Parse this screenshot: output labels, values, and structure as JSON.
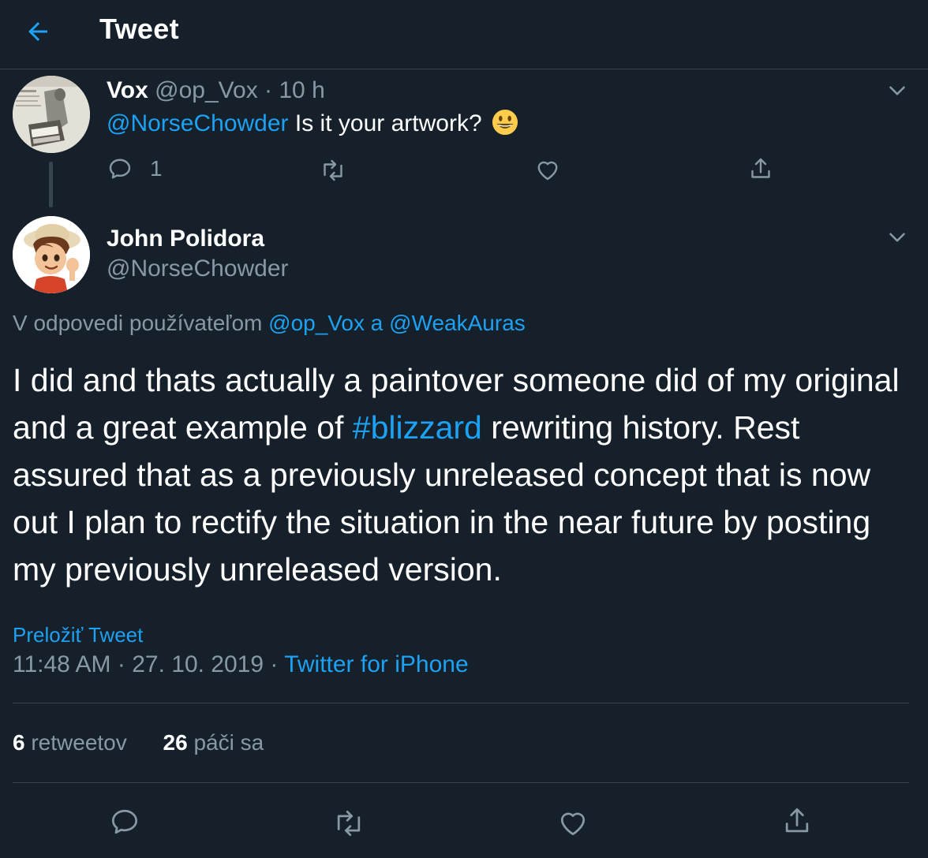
{
  "header": {
    "title": "Tweet",
    "back_icon": "arrow-left-icon",
    "accent": "#1da1f2"
  },
  "parent_tweet": {
    "name": "Vox",
    "handle": "@op_Vox",
    "separator": "·",
    "time": "10 h",
    "mention": "@NorseChowder",
    "text": "Is it your artwork?",
    "emoji": "smiling-face-icon",
    "reply_count": "1"
  },
  "main_tweet": {
    "name": "John Polidora",
    "handle": "@NorseChowder",
    "reply_prefix": "V odpovedi používateľom",
    "reply_user_1": "@op_Vox",
    "reply_conj": "a",
    "reply_user_2": "@WeakAuras",
    "text_before_tag": "I did and thats actually a paintover someone did of my original and a great example of ",
    "hashtag": "#blizzard",
    "text_after_tag": " rewriting history. Rest assured that as a previously unreleased concept that is now out I plan to rectify the situation in the near future by posting my previously unreleased version.",
    "translate_label": "Preložiť Tweet",
    "time": "11:48 AM",
    "date": "27. 10. 2019",
    "dot": "·",
    "source": "Twitter for iPhone",
    "retweets_count": "6",
    "retweets_label": "retweetov",
    "likes_count": "26",
    "likes_label": "páči sa"
  },
  "colors": {
    "background": "#15202b",
    "muted": "#8899a6",
    "link": "#1da1f2",
    "border": "#38444d"
  }
}
